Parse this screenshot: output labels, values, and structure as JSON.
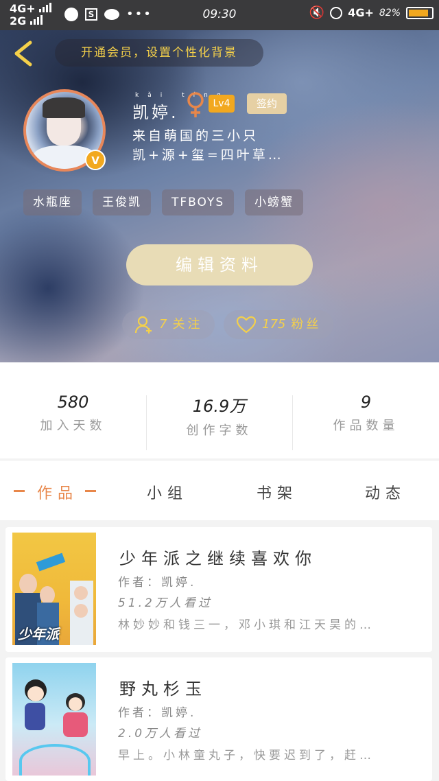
{
  "status_bar": {
    "network_top": "4G+",
    "network_bottom": "2G",
    "clock": "09:30",
    "network_right": "4G+",
    "battery": "82%"
  },
  "banner": {
    "text": "开通会员，设置个性化背景"
  },
  "profile": {
    "name": "凯婷.",
    "level": "Lv4",
    "signed": "签约",
    "bio_line1": "来自萌国的三小只",
    "bio_line2": "凯+源+玺=四叶草…",
    "tags": [
      "水瓶座",
      "王俊凯",
      "TFBOYS",
      "小螃蟹"
    ]
  },
  "edit_button": "编辑资料",
  "follow": {
    "count": "7",
    "label": "关注"
  },
  "fans": {
    "count": "175",
    "label": "粉丝"
  },
  "stats": [
    {
      "value": "580",
      "label": "加入天数"
    },
    {
      "value": "16.9万",
      "label": "创作字数"
    },
    {
      "value": "9",
      "label": "作品数量"
    }
  ],
  "tabs": [
    "作品",
    "小组",
    "书架",
    "动态"
  ],
  "books": [
    {
      "title": "少年派之继续喜欢你",
      "author": "作者：凯婷.",
      "views": "51.2万人看过",
      "desc": "林妙妙和钱三一，邓小琪和江天昊的…",
      "cover_text": "少年派"
    },
    {
      "title": "野丸杉玉",
      "author": "作者：凯婷.",
      "views": "2.0万人看过",
      "desc": "早上。小林童丸子，快要迟到了，赶…"
    }
  ],
  "colors": {
    "accent": "#e8874a",
    "gold": "#f4d04a",
    "badge": "#f2a81f"
  }
}
